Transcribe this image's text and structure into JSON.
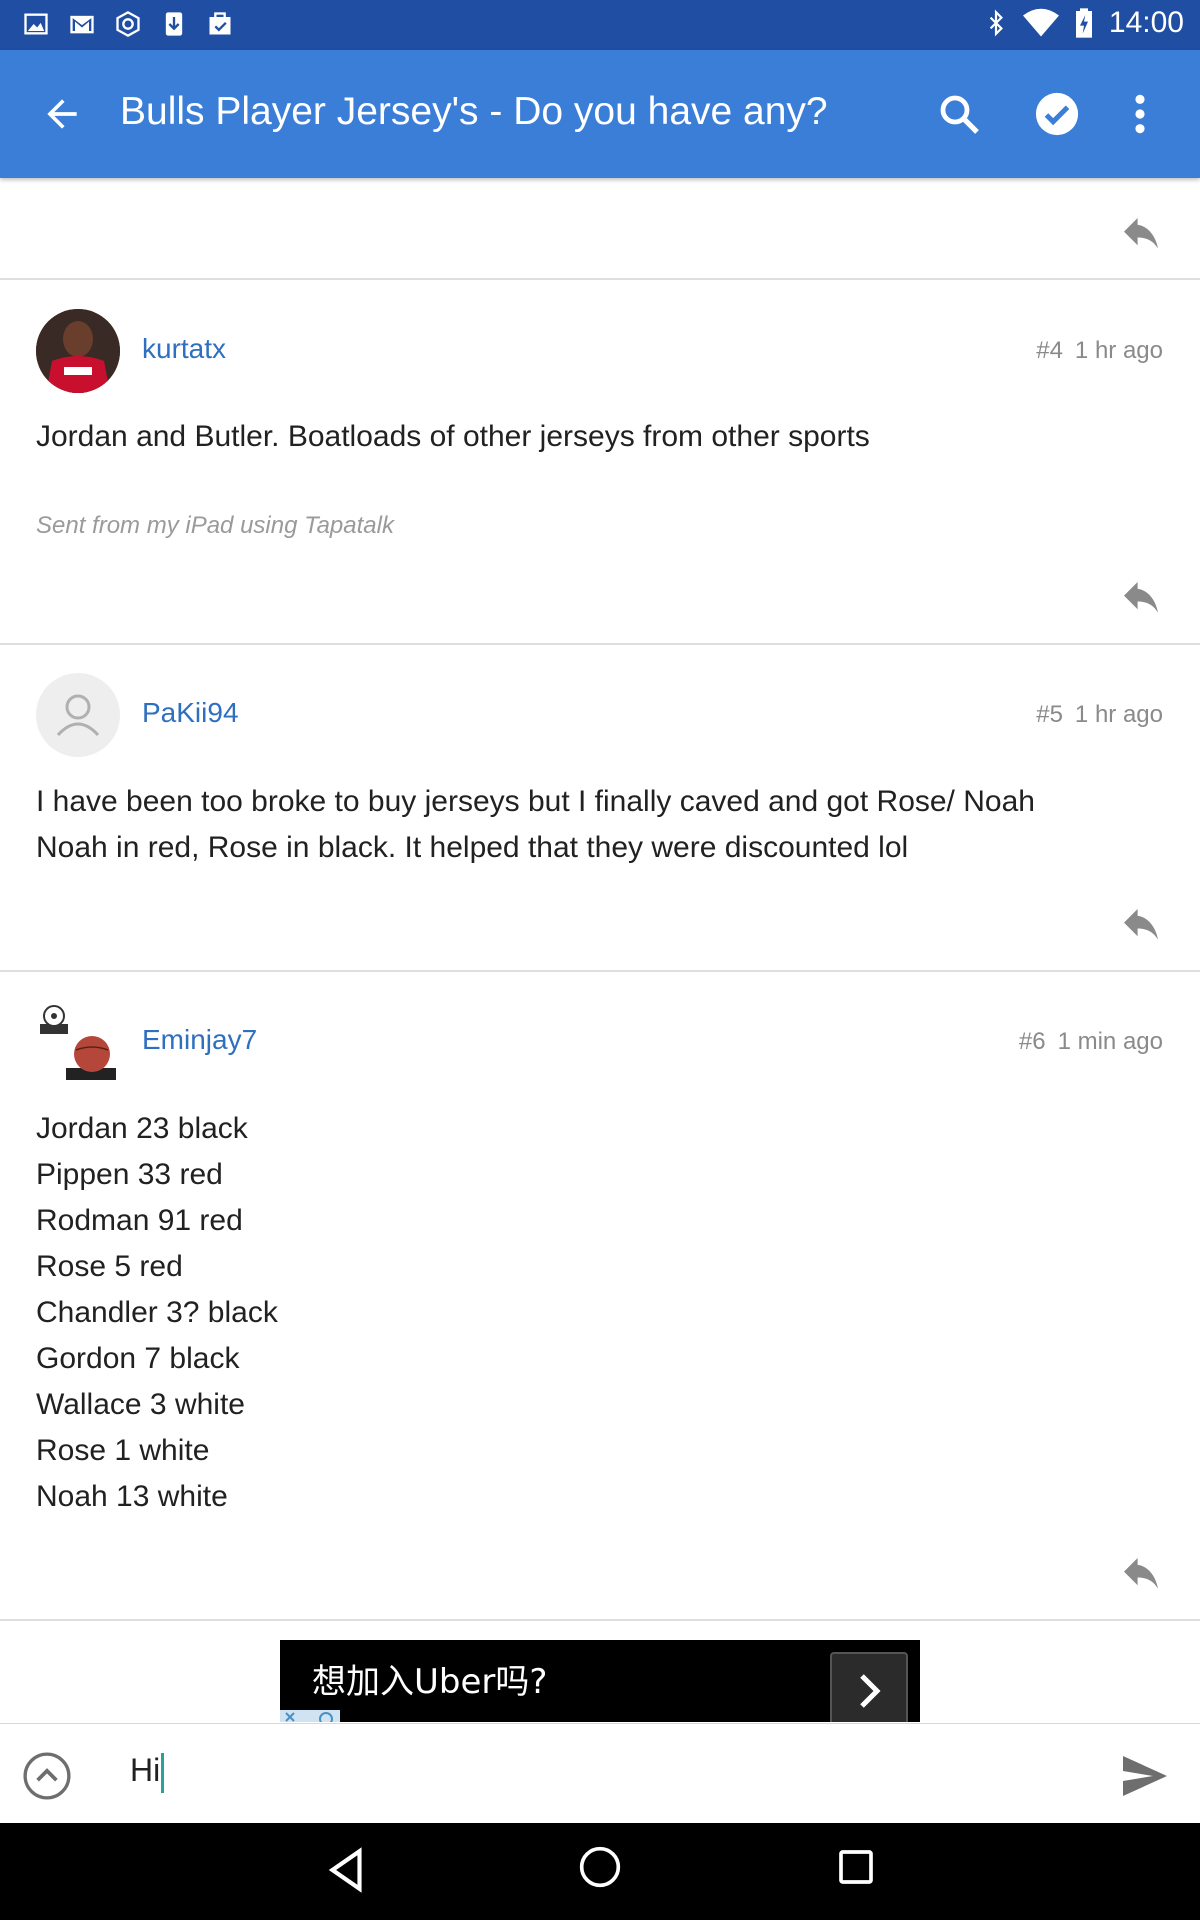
{
  "status_bar": {
    "time": "14:00",
    "left_icons": [
      "gallery-icon",
      "gmail-icon",
      "sync-icon",
      "download-icon",
      "task-icon"
    ],
    "right_icons": [
      "bluetooth-icon",
      "wifi-icon",
      "battery-charging-icon"
    ]
  },
  "app_bar": {
    "title": "Bulls Player Jersey's - Do you have any?",
    "icons": [
      "back-arrow-icon",
      "search-icon",
      "check-icon",
      "more-vert-icon"
    ],
    "color": "#3b7ed8"
  },
  "posts": [
    {
      "username": "kurtatx",
      "post_number": "#4",
      "time": "1 hr ago",
      "avatar": "bulls-player-avatar",
      "lines": [
        "Jordan and Butler. Boatloads of other jerseys from other sports"
      ],
      "signature": "Sent from my iPad using Tapatalk"
    },
    {
      "username": "PaKii94",
      "post_number": "#5",
      "time": "1 hr ago",
      "avatar": "default-user-avatar",
      "lines": [
        "I have been too broke to buy jerseys but I finally caved and got Rose/ Noah",
        "Noah in red, Rose in black. It helped that they were discounted lol"
      ]
    },
    {
      "username": "Eminjay7",
      "post_number": "#6",
      "time": "1 min ago",
      "avatar": "balls-avatar",
      "lines": [
        "Jordan 23 black",
        "Pippen 33 red",
        "Rodman 91 red",
        "Rose 5 red",
        "Chandler 3? black",
        "Gordon 7 black",
        "Wallace 3 white",
        "Rose 1 white",
        "Noah 13 white"
      ]
    }
  ],
  "ad": {
    "text": "想加入Uber吗?"
  },
  "composer": {
    "value": "Hi"
  },
  "colors": {
    "link": "#2f6fbf",
    "status_bar": "#1f4ea3"
  }
}
